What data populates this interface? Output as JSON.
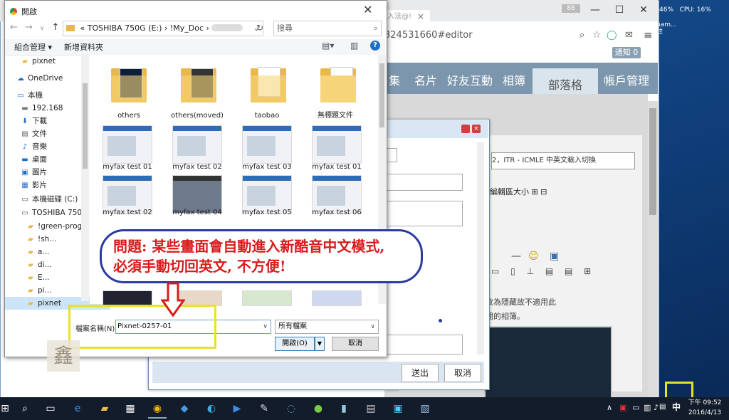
{
  "colors": {
    "accent": "#7c97ad",
    "callout_border": "#2a3aa0",
    "callout_text": "#d81b1b",
    "highlight": "#e8e02a",
    "arrow": "#d81b1b"
  },
  "system": {
    "mem": "46%",
    "cpu": "CPU: 16%",
    "side_lines": [
      "nam...",
      "註"
    ]
  },
  "browser": {
    "tab_fragment": "入法@!",
    "profile_num": "88",
    "url_fragment": "324531660#editor",
    "notify": "通知 0",
    "nav_tabs": [
      {
        "label": "集"
      },
      {
        "label": "名片"
      },
      {
        "label": "好友互動"
      },
      {
        "label": "相簿"
      },
      {
        "label": "部落格",
        "active": true
      },
      {
        "label": "帳戶管理"
      }
    ],
    "title_field": "2，ITR - ICMLE 中英文輸入切換",
    "edit_size": "編輯區大小",
    "hidden_note_1": "改為隱藏故不適用此",
    "hidden_note_2": "開的相簿。"
  },
  "embedded_dialog": {
    "submit_label": "送出",
    "cancel_label": "取消"
  },
  "file_dialog": {
    "title": "開啟",
    "path": [
      "«",
      "TOSHIBA 750G (E:)",
      "›",
      "!My_Doc",
      "›"
    ],
    "search_placeholder": "搜尋",
    "organize": "組合管理 ▾",
    "new_folder": "新增資料夾",
    "help": "?",
    "sidebar": [
      {
        "label": "pixnet",
        "icon": "folder-icon"
      },
      {
        "label": "OneDrive",
        "icon": "cloud-icon"
      },
      {
        "label": "本機",
        "icon": "computer-icon"
      },
      {
        "label": "192.168",
        "icon": "network-icon"
      },
      {
        "label": "下載",
        "icon": "download-icon"
      },
      {
        "label": "文件",
        "icon": "document-icon"
      },
      {
        "label": "音樂",
        "icon": "music-icon"
      },
      {
        "label": "桌面",
        "icon": "desktop-icon"
      },
      {
        "label": "圖片",
        "icon": "image-icon"
      },
      {
        "label": "影片",
        "icon": "video-icon"
      },
      {
        "label": "本機磁碟 (C:)",
        "icon": "drive-icon"
      },
      {
        "label": "TOSHIBA 750G",
        "icon": "drive-icon"
      },
      {
        "label": "!green-prog",
        "icon": "folder-icon"
      },
      {
        "label": "!sh...",
        "icon": "folder-icon"
      },
      {
        "label": "a...",
        "icon": "folder-icon"
      },
      {
        "label": "di...",
        "icon": "folder-icon"
      },
      {
        "label": "E...",
        "icon": "folder-icon"
      },
      {
        "label": "pi...",
        "icon": "folder-icon"
      },
      {
        "label": "pixnet",
        "icon": "folder-icon",
        "selected": true
      }
    ],
    "folders": [
      {
        "label": "others"
      },
      {
        "label": "others(moved)"
      },
      {
        "label": "taobao"
      },
      {
        "label": "無標題文件"
      }
    ],
    "thumbs_row1": [
      "myfax test 01",
      "myfax test 02",
      "myfax test 03",
      "myfax test 01"
    ],
    "thumbs_row2": [
      "myfax test 02",
      "myfax test 04",
      "myfax test 05",
      "myfax test 06"
    ],
    "filename_label": "檔案名稱(N):",
    "filename_value": "Pixnet-0257-01",
    "filetype_value": "所有檔案",
    "open_label": "開啟(O)",
    "cancel_label": "取消"
  },
  "callout": {
    "line1": "問題: 某些畫面會自動進入新酷音中文模式,",
    "line2": "必須手動切回英文, 不方便!"
  },
  "watermark": "鑫",
  "taskbar": {
    "ime": "中",
    "time": "下午 09:52",
    "date": "2016/4/13"
  }
}
